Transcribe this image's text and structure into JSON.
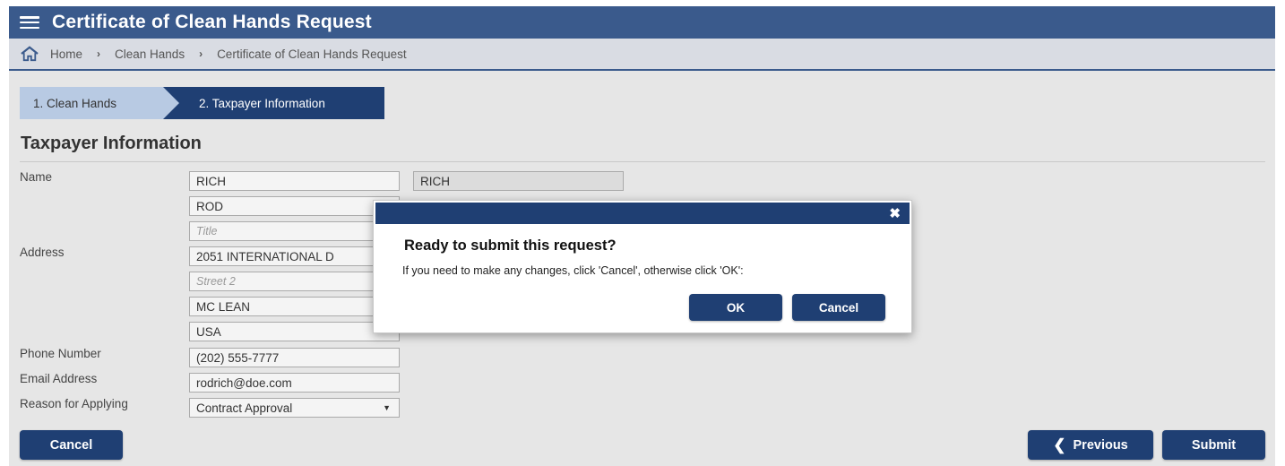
{
  "header": {
    "title": "Certificate of Clean Hands Request"
  },
  "breadcrumb": {
    "items": [
      "Home",
      "Clean Hands",
      "Certificate of Clean Hands Request"
    ]
  },
  "steps": {
    "step1": "1. Clean Hands",
    "step2": "2. Taxpayer Information"
  },
  "section": {
    "title": "Taxpayer Information"
  },
  "labels": {
    "name": "Name",
    "address": "Address",
    "phone": "Phone Number",
    "email": "Email Address",
    "reason": "Reason for Applying"
  },
  "fields": {
    "first_name": "RICH",
    "first_name_ro": "RICH",
    "last_name": "ROD",
    "title_placeholder": "Title",
    "street1": "2051 INTERNATIONAL D",
    "street2_placeholder": "Street 2",
    "city": "MC LEAN",
    "country": "USA",
    "phone": "(202) 555-7777",
    "email": "rodrich@doe.com",
    "reason": "Contract Approval"
  },
  "buttons": {
    "cancel": "Cancel",
    "previous": "Previous",
    "submit": "Submit"
  },
  "dialog": {
    "title": "Ready to submit this request?",
    "message": "If you need to make any changes, click 'Cancel', otherwise click 'OK':",
    "ok": "OK",
    "cancel": "Cancel"
  },
  "colors": {
    "primary": "#1f3f73",
    "header": "#3a5a8c",
    "step_inactive": "#b8cae3"
  }
}
